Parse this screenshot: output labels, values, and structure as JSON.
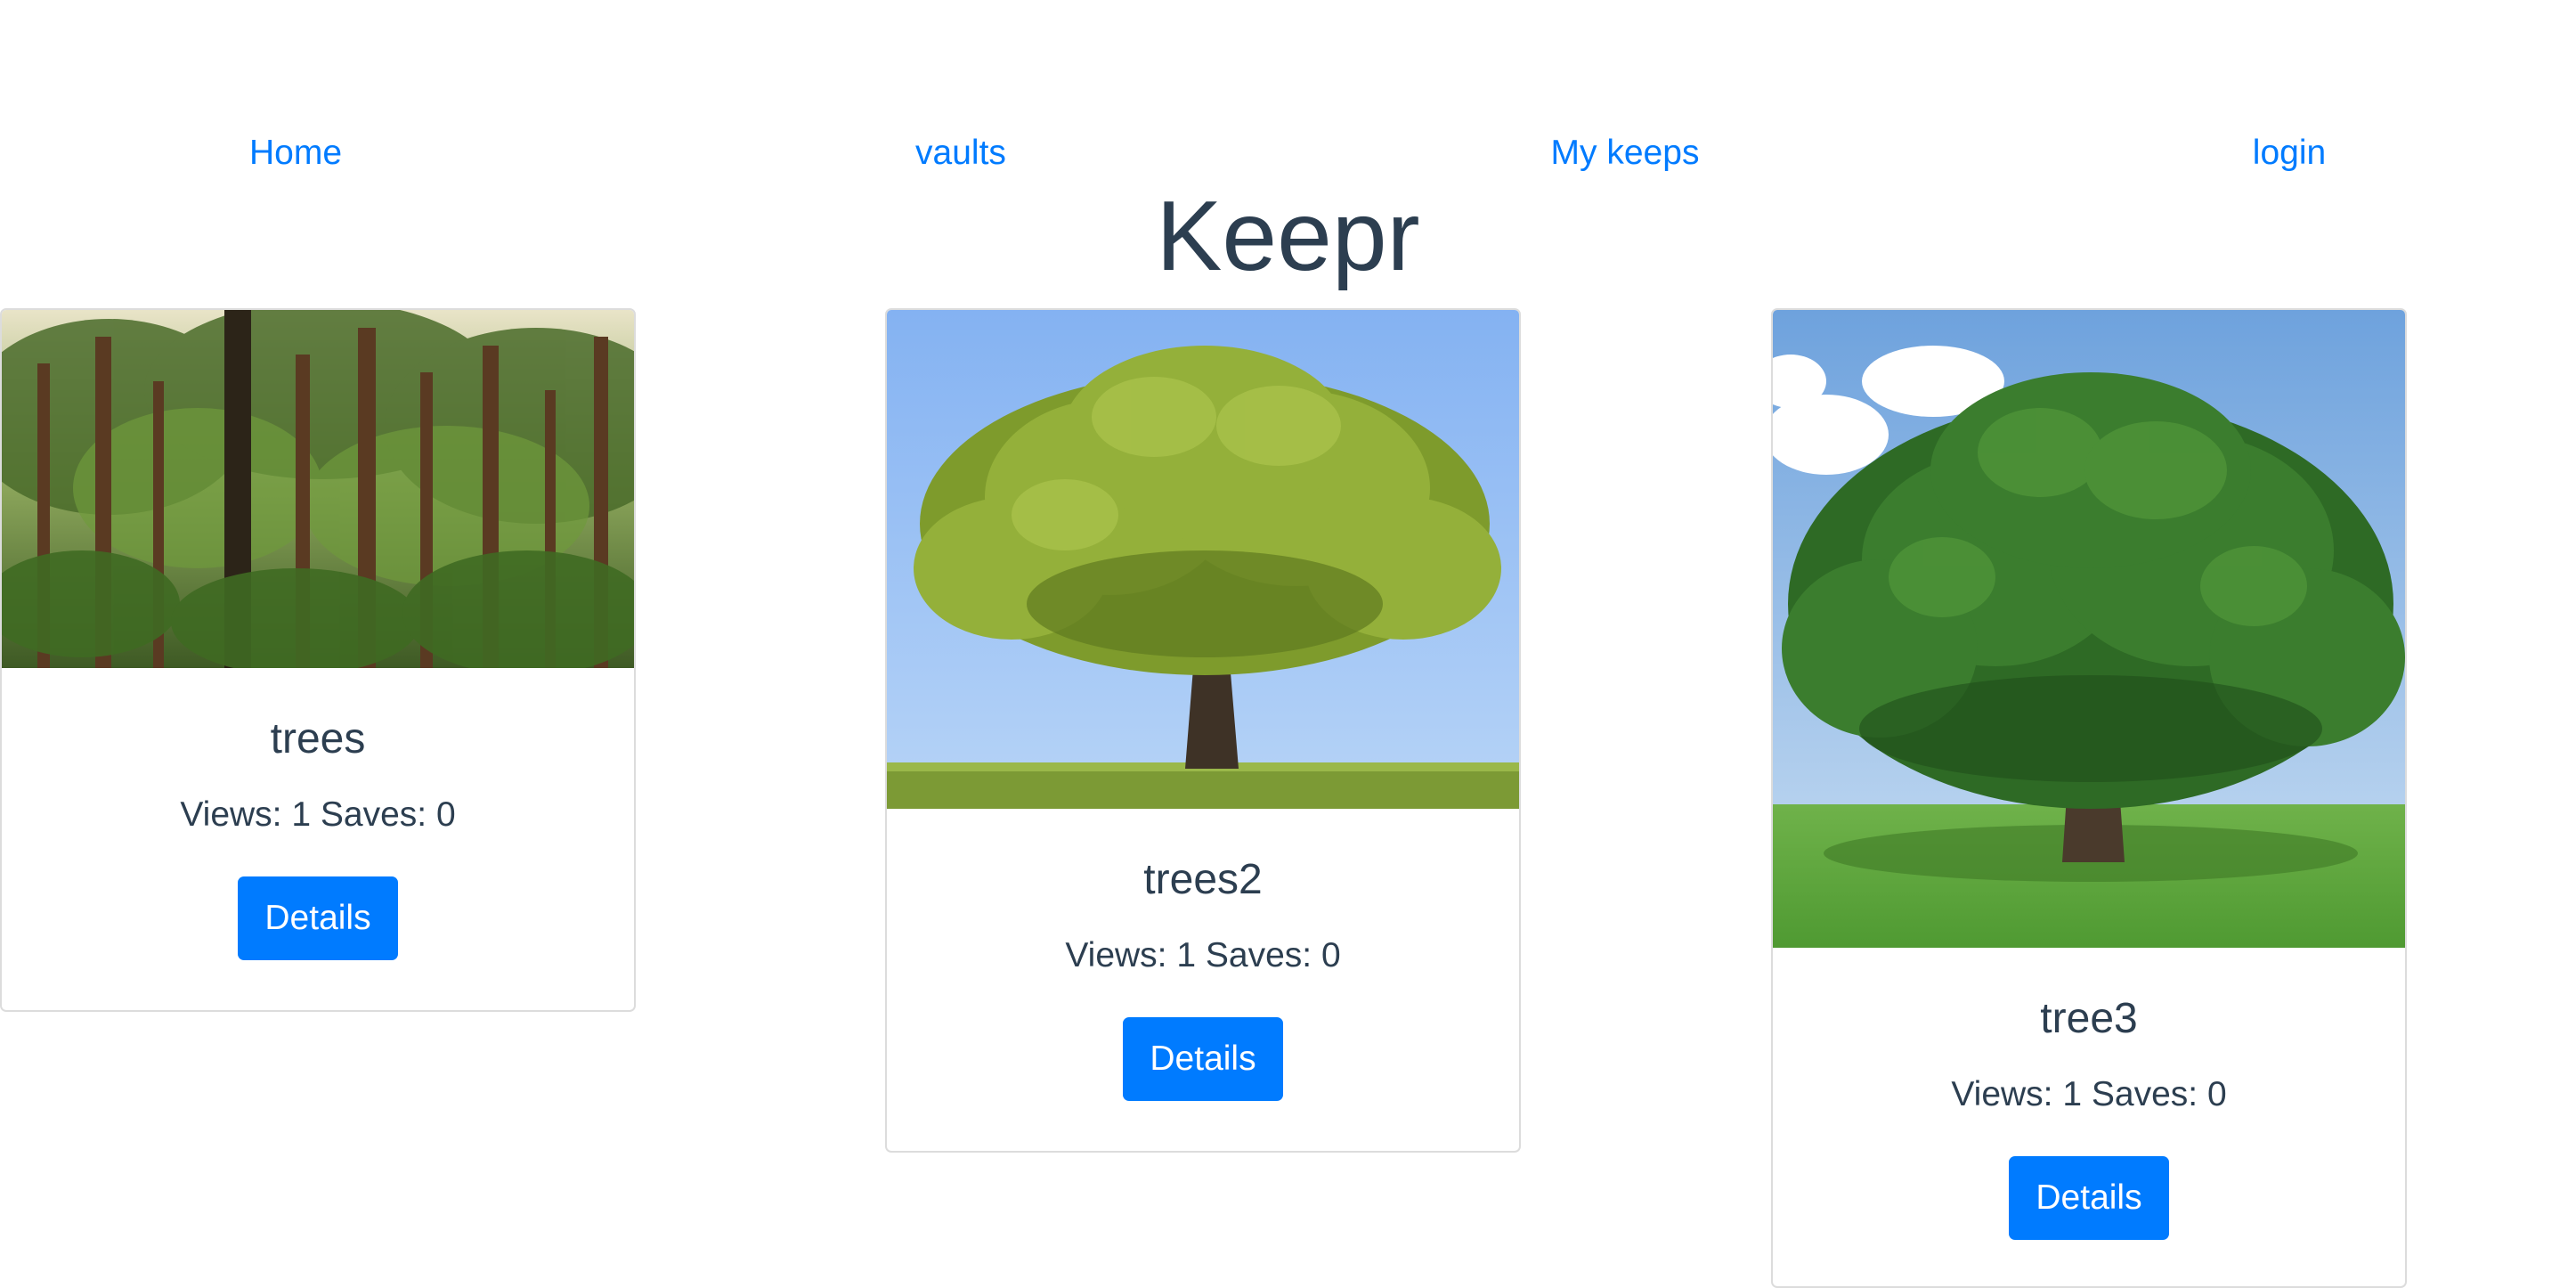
{
  "nav": {
    "home": "Home",
    "vaults": "vaults",
    "my_keeps": "My keeps",
    "login": "login"
  },
  "app_title": "Keepr",
  "keeps": [
    {
      "name": "trees",
      "views_saves": "Views: 1 Saves: 0",
      "details_label": "Details",
      "image": "forest-photo"
    },
    {
      "name": "trees2",
      "views_saves": "Views: 1 Saves: 0",
      "details_label": "Details",
      "image": "oak-tree-photo"
    },
    {
      "name": "tree3",
      "views_saves": "Views: 1 Saves: 0",
      "details_label": "Details",
      "image": "tree-in-field-photo"
    }
  ],
  "colors": {
    "link": "#007bff",
    "button": "#007bff",
    "text": "#2c3e50"
  }
}
